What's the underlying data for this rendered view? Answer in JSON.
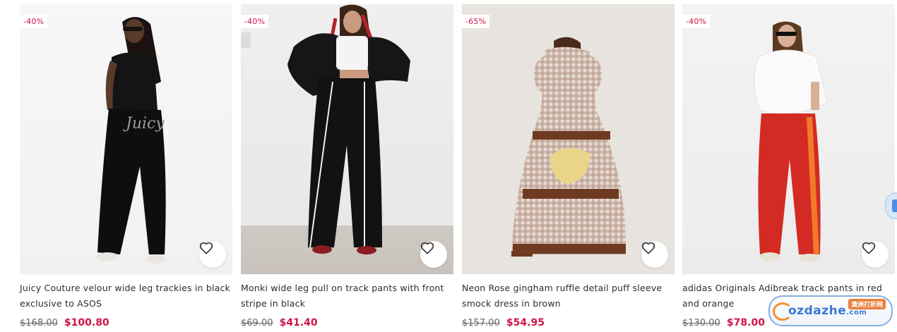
{
  "products": [
    {
      "discount": "-40%",
      "title": "Juicy Couture velour wide leg trackies in black exclusive to ASOS",
      "price_was": "$168.00",
      "price_now": "$100.80"
    },
    {
      "discount": "-40%",
      "title": "Monki wide leg pull on track pants with front stripe in black",
      "price_was": "$69.00",
      "price_now": "$41.40"
    },
    {
      "discount": "-65%",
      "title": "Neon Rose gingham ruffle detail puff sleeve smock dress in brown",
      "price_was": "$157.00",
      "price_now": "$54.95"
    },
    {
      "discount": "-40%",
      "title": "adidas Originals Adibreak track pants in red and orange",
      "price_was": "$130.00",
      "price_now": "$78.00"
    }
  ],
  "watermark": {
    "word": "ozdazhe",
    "sub": "澳洲打折网",
    "suffix": ".com"
  },
  "colors": {
    "sale": "#d01345",
    "text": "#2d2d2d"
  },
  "icons": {
    "favorite": "heart-icon"
  }
}
